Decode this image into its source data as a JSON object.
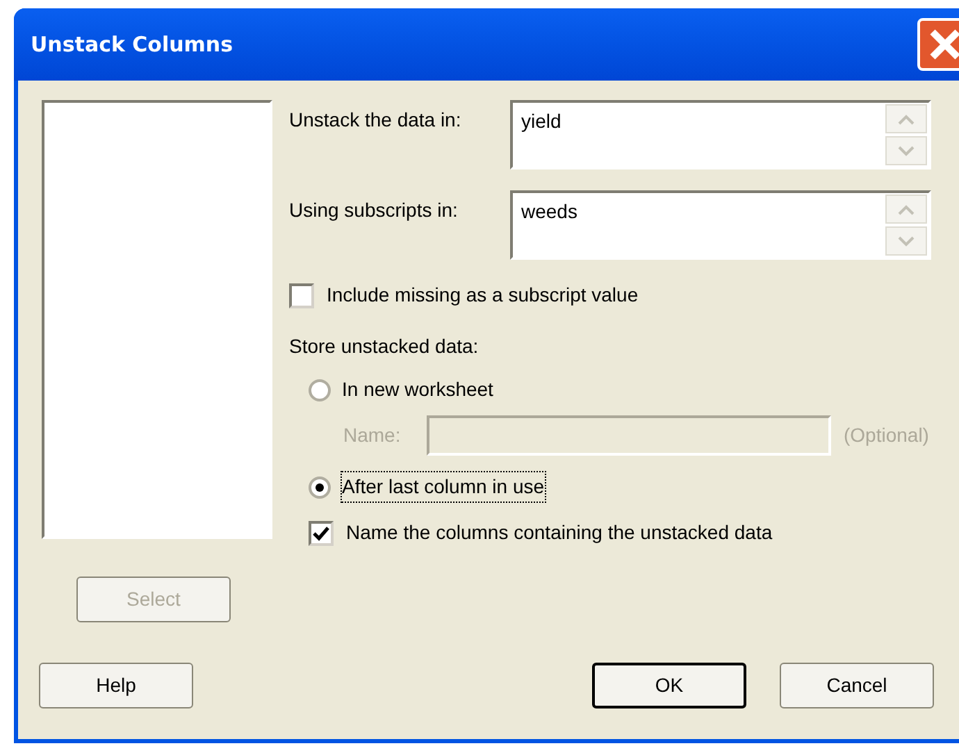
{
  "window": {
    "title": "Unstack Columns"
  },
  "fields": [
    {
      "label": "Unstack the data in:",
      "value": "yield"
    },
    {
      "label": "Using subscripts in:",
      "value": "weeds"
    }
  ],
  "include_missing": {
    "label": "Include missing as a subscript value",
    "checked": false
  },
  "store": {
    "label": "Store unstacked data:",
    "options": [
      {
        "label": "In new worksheet",
        "selected": false,
        "focused": false
      },
      {
        "label": "After last column in use",
        "selected": true,
        "focused": true
      }
    ],
    "name_field": {
      "label": "Name:",
      "note": "(Optional)",
      "disabled": true
    }
  },
  "name_columns": {
    "label": "Name the columns containing the unstacked data",
    "checked": true
  },
  "buttons": [
    {
      "kind": "select",
      "label": "Select",
      "disabled": true,
      "default": false
    },
    {
      "kind": "help",
      "label": "Help",
      "disabled": false,
      "default": false
    },
    {
      "kind": "ok",
      "label": "OK",
      "disabled": false,
      "default": true
    },
    {
      "kind": "cancel",
      "label": "Cancel",
      "disabled": false,
      "default": false
    }
  ]
}
